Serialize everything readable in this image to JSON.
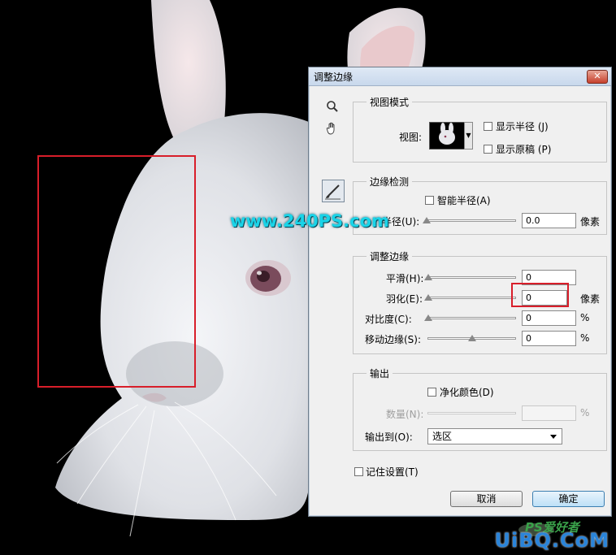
{
  "dialog": {
    "title": "调整边缘",
    "close_symbol": "✕"
  },
  "tools": {
    "zoom_icon": "zoom-icon",
    "hand_icon": "hand-icon",
    "brush_icon": "refine-radius-brush-icon"
  },
  "view_mode": {
    "group_label": "视图模式",
    "view_label": "视图:",
    "show_radius_label": "显示半径 (J)",
    "show_original_label": "显示原稿 (P)"
  },
  "edge_detection": {
    "group_label": "边缘检测",
    "smart_radius_label": "智能半径(A)",
    "radius_label": "半径(U):",
    "radius_value": "0.0",
    "radius_unit": "像素"
  },
  "adjust_edge": {
    "group_label": "调整边缘",
    "smooth_label": "平滑(H):",
    "smooth_value": "0",
    "feather_label": "羽化(E):",
    "feather_value": "0",
    "feather_unit": "像素",
    "contrast_label": "对比度(C):",
    "contrast_value": "0",
    "contrast_unit": "%",
    "shift_label": "移动边缘(S):",
    "shift_value": "0",
    "shift_unit": "%",
    "shift_level": 0.5
  },
  "output": {
    "group_label": "输出",
    "decontaminate_label": "净化颜色(D)",
    "amount_label": "数量(N):",
    "amount_unit": "%",
    "output_to_label": "输出到(O):",
    "output_to_value": "选区"
  },
  "remember_label": "记住设置(T)",
  "buttons": {
    "cancel": "取消",
    "ok": "确定"
  },
  "watermarks": {
    "site1": "www.240PS.com",
    "site2": "UiBQ.CoM",
    "site3": "PS爱好者"
  },
  "colors": {
    "annotation_red": "#d81e2a",
    "watermark_cyan": "#19d4e8",
    "watermark_blue": "#2a84d9"
  }
}
